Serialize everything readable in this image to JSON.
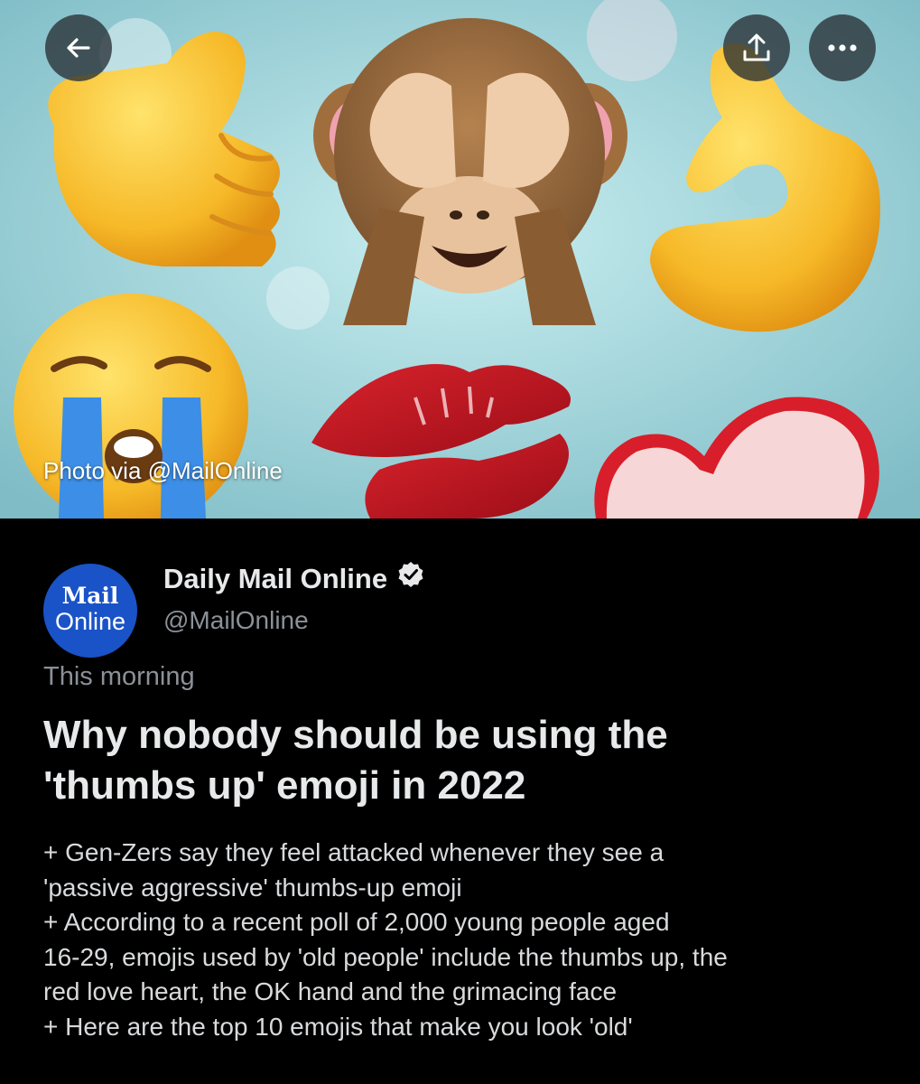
{
  "hero": {
    "photo_credit": "Photo via @MailOnline"
  },
  "top_actions": {
    "back_icon": "arrow-left-icon",
    "share_icon": "share-upload-icon",
    "more_icon": "more-dots-icon"
  },
  "author": {
    "avatar_line1": "Mail",
    "avatar_line2": "Online",
    "display_name": "Daily Mail Online",
    "handle": "@MailOnline",
    "verified": true,
    "avatar_color": "#1a53c7"
  },
  "article": {
    "time": "This morning",
    "headline_line1": "Why nobody should be using the",
    "headline_line2": "'thumbs up' emoji in 2022",
    "body_lines": [
      "+ Gen-Zers say they feel attacked whenever they see a",
      "'passive aggressive' thumbs-up emoji",
      "+ According to a recent poll of 2,000 young people aged",
      "16-29, emojis used by 'old people' include the thumbs up, the",
      "red love heart, the OK hand and the grimacing face",
      "+ Here are the top 10 emojis that make you look 'old'"
    ]
  }
}
